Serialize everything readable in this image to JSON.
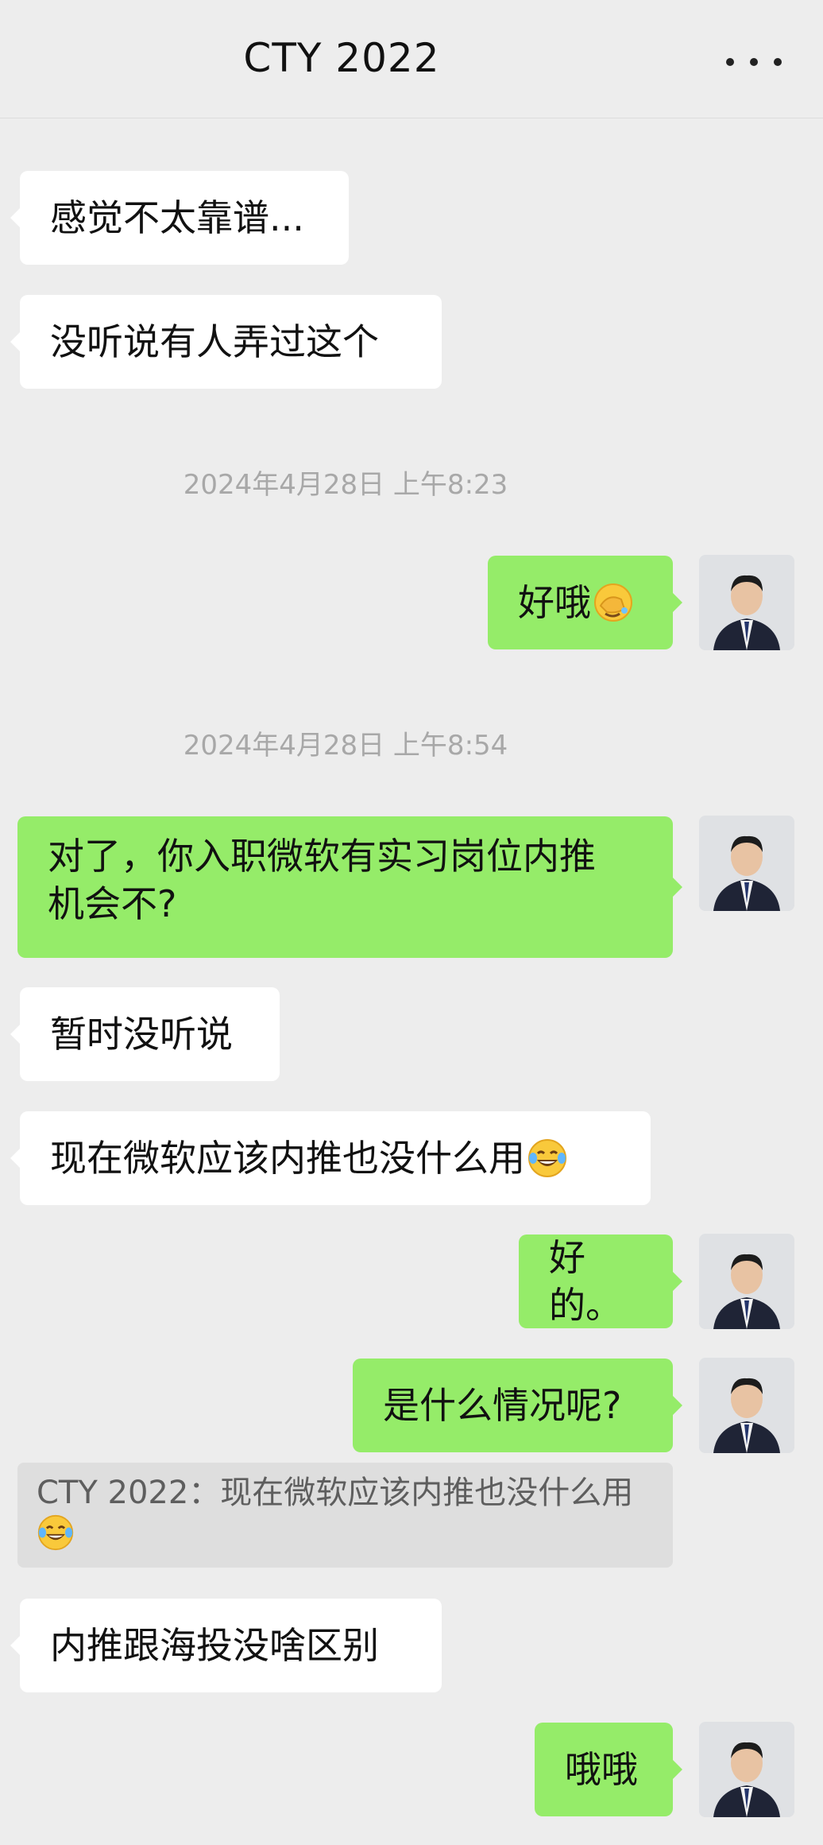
{
  "header": {
    "title": "CTY 2022",
    "more_icon": "more-dots-icon"
  },
  "messages": {
    "m1": "感觉不太靠谱...",
    "m2": "没听说有人弄过这个",
    "t1": "2024年4月28日 上午8:23",
    "m3": "好哦",
    "t2": "2024年4月28日 上午8:54",
    "m4_line1": "对了，你入职微软有实习岗位内推",
    "m4_line2": "机会不?",
    "m5": "暂时没听说",
    "m6": "现在微软应该内推也没什么用",
    "m7": "好的。",
    "m8": "是什么情况呢?",
    "quote": "CTY 2022：现在微软应该内推也没什么用",
    "m9": "内推跟海投没啥区别",
    "m10": "哦哦"
  },
  "colors": {
    "background": "#ededed",
    "incoming": "#ffffff",
    "outgoing": "#95ec69",
    "timestamp": "#a8a8a8"
  },
  "icons": {
    "face_palm": "face-with-hand-over-eyes-emoji",
    "laugh": "tears-of-joy-emoji"
  }
}
